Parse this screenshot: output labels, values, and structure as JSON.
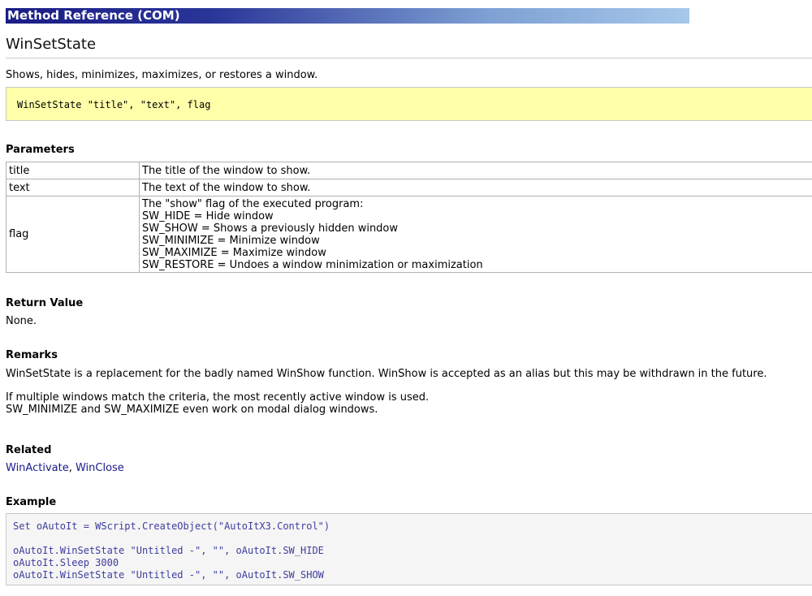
{
  "banner": "Method Reference (COM)",
  "title": "WinSetState",
  "description": "Shows, hides, minimizes, maximizes, or restores a window.",
  "syntax": "WinSetState \"title\", \"text\", flag",
  "parameters": {
    "heading": "Parameters",
    "rows": [
      {
        "name": "title",
        "desc": "The title of the window to show."
      },
      {
        "name": "text",
        "desc": "The text of the window to show."
      },
      {
        "name": "flag",
        "desc_lines": [
          "The \"show\" flag of the executed program:",
          "SW_HIDE = Hide window",
          "SW_SHOW = Shows a previously hidden window",
          "SW_MINIMIZE = Minimize window",
          "SW_MAXIMIZE = Maximize window",
          "SW_RESTORE = Undoes a window minimization or maximization"
        ]
      }
    ]
  },
  "return_value": {
    "heading": "Return Value",
    "text": "None."
  },
  "remarks": {
    "heading": "Remarks",
    "p1": "WinSetState is a replacement for the badly named WinShow function. WinShow is accepted as an alias but this may be withdrawn in the future.",
    "p2_line1": "If multiple windows match the criteria, the most recently active window is used.",
    "p2_line2": "SW_MINIMIZE and SW_MAXIMIZE even work on modal dialog windows."
  },
  "related": {
    "heading": "Related",
    "links": [
      "WinActivate",
      "WinClose"
    ],
    "separator": ", "
  },
  "example": {
    "heading": "Example",
    "lines": [
      "Set oAutoIt = WScript.CreateObject(\"AutoItX3.Control\")",
      "",
      "oAutoIt.WinSetState \"Untitled -\", \"\", oAutoIt.SW_HIDE",
      "oAutoIt.Sleep 3000",
      "oAutoIt.WinSetState \"Untitled -\", \"\", oAutoIt.SW_SHOW"
    ]
  }
}
